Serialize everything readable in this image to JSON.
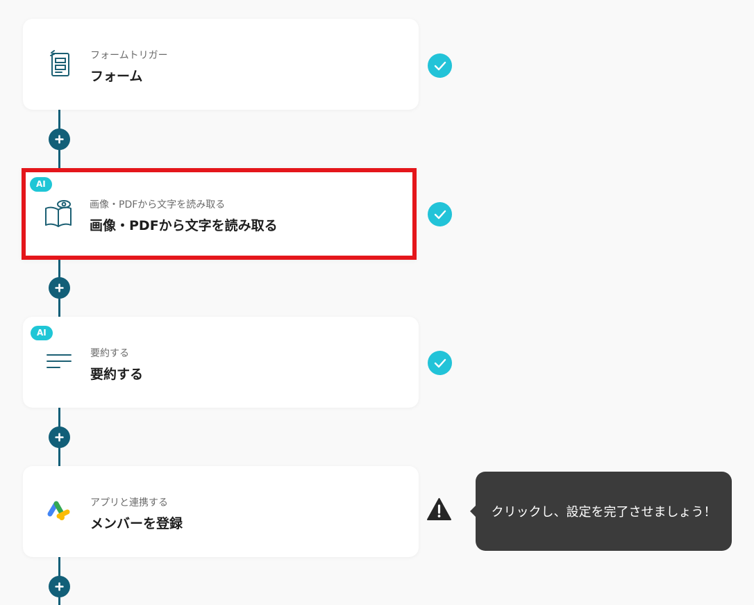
{
  "steps": [
    {
      "subtitle": "フォームトリガー",
      "title": "フォーム",
      "icon": "form-icon",
      "ai": false,
      "status": "complete"
    },
    {
      "subtitle": "画像・PDFから文字を読み取る",
      "title": "画像・PDFから文字を読み取る",
      "icon": "ocr-book-eye-icon",
      "ai": true,
      "ai_label": "AI",
      "status": "complete",
      "highlighted": true
    },
    {
      "subtitle": "要約する",
      "title": "要約する",
      "icon": "summary-lines-icon",
      "ai": true,
      "ai_label": "AI",
      "status": "complete"
    },
    {
      "subtitle": "アプリと連携する",
      "title": "メンバーを登録",
      "icon": "app-integration-icon",
      "ai": false,
      "status": "warning"
    }
  ],
  "tooltip": {
    "text": "クリックし、設定を完了させましょう！"
  },
  "colors": {
    "connector": "#125f78",
    "complete": "#22c3d8",
    "ai_badge": "#1fc6d6",
    "highlight_border": "#e4161b",
    "tooltip_bg": "#3b3b3b"
  }
}
